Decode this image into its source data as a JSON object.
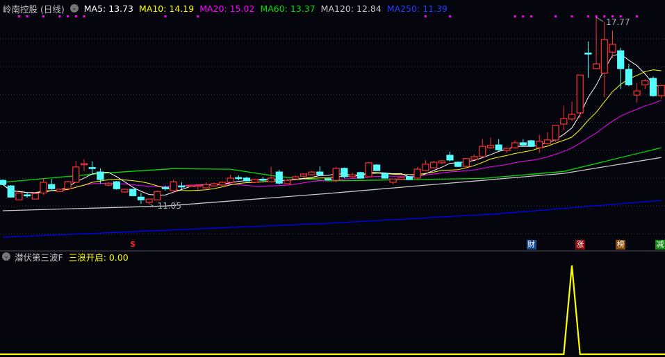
{
  "header": {
    "title": "岭南控股 (日线)",
    "ma5": "MA5: 13.73",
    "ma10": "MA10: 14.19",
    "ma20": "MA20: 15.02",
    "ma60": "MA60: 13.37",
    "ma120": "MA120: 12.84",
    "ma250": "MA250: 11.39"
  },
  "annotations": {
    "high_label": "17.77",
    "low_label": "11.05"
  },
  "markers": [
    {
      "text": "S",
      "index": 16,
      "color": "#ff2020"
    },
    {
      "text": "财",
      "index": 65,
      "color": "#1a4a8a"
    },
    {
      "text": "涨",
      "index": 71,
      "color": "#8a0a0a"
    },
    {
      "text": "榜",
      "index": 76,
      "color": "#8a4a0a"
    },
    {
      "text": "减",
      "index": 81,
      "color": "#108a10"
    }
  ],
  "sub": {
    "title": "潜伏第三波F",
    "value_label": "三浪开启: 0.00"
  },
  "colors": {
    "up": "#ff3232",
    "down": "#54ffff",
    "ma5": "#ffffff",
    "ma10": "#ffff00",
    "ma20": "#ff00ff",
    "ma60": "#00e000",
    "ma120": "#c8c8c8",
    "ma250": "#0000ff",
    "signal": "#ff00ff",
    "indicator": "#ffff00"
  },
  "chart_data": {
    "type": "candlestick",
    "title": "岭南控股 (日线)",
    "ohlc_fields": [
      "open",
      "high",
      "low",
      "close"
    ],
    "candles": [
      [
        11.92,
        11.95,
        11.75,
        11.77
      ],
      [
        11.72,
        11.75,
        11.3,
        11.32
      ],
      [
        11.22,
        11.47,
        11.22,
        11.47
      ],
      [
        11.4,
        11.5,
        11.3,
        11.37
      ],
      [
        11.25,
        11.45,
        11.25,
        11.45
      ],
      [
        11.47,
        12.0,
        11.4,
        11.85
      ],
      [
        11.77,
        11.97,
        11.57,
        11.62
      ],
      [
        11.52,
        11.62,
        11.5,
        11.6
      ],
      [
        11.62,
        11.9,
        11.6,
        11.87
      ],
      [
        11.85,
        12.62,
        11.85,
        12.4
      ],
      [
        12.48,
        12.68,
        12.25,
        12.52
      ],
      [
        12.38,
        12.6,
        12.15,
        12.35
      ],
      [
        12.22,
        12.35,
        11.8,
        11.95
      ],
      [
        11.75,
        11.85,
        11.7,
        11.82
      ],
      [
        11.87,
        11.9,
        11.58,
        11.62
      ],
      [
        11.5,
        11.62,
        11.48,
        11.6
      ],
      [
        11.6,
        11.62,
        11.35,
        11.37
      ],
      [
        11.32,
        11.47,
        11.08,
        11.22
      ],
      [
        11.13,
        11.25,
        11.05,
        11.25
      ],
      [
        11.22,
        11.55,
        11.2,
        11.52
      ],
      [
        11.67,
        11.72,
        11.55,
        11.62
      ],
      [
        11.55,
        11.95,
        11.45,
        11.87
      ],
      [
        11.72,
        11.85,
        11.6,
        11.7
      ],
      [
        11.7,
        11.75,
        11.68,
        11.74
      ],
      [
        11.7,
        11.76,
        11.58,
        11.74
      ],
      [
        11.65,
        11.85,
        11.62,
        11.77
      ],
      [
        11.72,
        11.85,
        11.7,
        11.8
      ],
      [
        11.75,
        11.88,
        11.72,
        11.85
      ],
      [
        11.85,
        12.12,
        11.82,
        12.0
      ],
      [
        12.02,
        12.1,
        11.92,
        12.0
      ],
      [
        12.0,
        12.05,
        11.88,
        11.9
      ],
      [
        11.85,
        11.98,
        11.82,
        11.95
      ],
      [
        11.96,
        12.05,
        11.88,
        11.94
      ],
      [
        11.87,
        12.4,
        11.85,
        12.0
      ],
      [
        12.22,
        12.3,
        11.78,
        11.82
      ],
      [
        11.8,
        11.97,
        11.78,
        11.92
      ],
      [
        11.97,
        12.1,
        11.95,
        12.05
      ],
      [
        12.07,
        12.17,
        12.0,
        12.15
      ],
      [
        12.12,
        12.25,
        12.1,
        12.22
      ],
      [
        12.22,
        12.42,
        12.1,
        12.12
      ],
      [
        11.98,
        12.0,
        11.92,
        11.95
      ],
      [
        11.92,
        12.4,
        11.85,
        12.35
      ],
      [
        12.35,
        12.38,
        12.0,
        12.05
      ],
      [
        12.05,
        12.2,
        12.0,
        12.12
      ],
      [
        12.2,
        12.23,
        11.97,
        12.0
      ],
      [
        12.05,
        12.58,
        12.02,
        12.55
      ],
      [
        12.47,
        12.5,
        12.25,
        12.27
      ],
      [
        12.17,
        12.2,
        11.98,
        12.0
      ],
      [
        11.85,
        11.98,
        11.78,
        11.97
      ],
      [
        11.95,
        12.05,
        11.93,
        12.02
      ],
      [
        12.05,
        12.07,
        11.92,
        11.95
      ],
      [
        12.0,
        12.4,
        11.97,
        12.32
      ],
      [
        12.27,
        12.65,
        12.25,
        12.5
      ],
      [
        12.37,
        12.62,
        12.35,
        12.57
      ],
      [
        12.55,
        12.65,
        12.5,
        12.62
      ],
      [
        12.82,
        12.95,
        12.6,
        12.65
      ],
      [
        12.57,
        12.6,
        12.4,
        12.42
      ],
      [
        12.42,
        12.72,
        12.4,
        12.7
      ],
      [
        12.67,
        12.85,
        12.65,
        12.77
      ],
      [
        12.77,
        13.4,
        12.75,
        13.14
      ],
      [
        13.09,
        13.45,
        13.05,
        13.17
      ],
      [
        13.19,
        13.4,
        12.98,
        13.02
      ],
      [
        12.99,
        13.1,
        12.9,
        13.07
      ],
      [
        13.09,
        13.35,
        13.05,
        13.27
      ],
      [
        13.27,
        13.4,
        13.15,
        13.19
      ],
      [
        13.34,
        13.37,
        13.12,
        13.14
      ],
      [
        13.09,
        13.55,
        12.9,
        13.32
      ],
      [
        13.24,
        13.65,
        13.2,
        13.37
      ],
      [
        13.37,
        13.9,
        13.3,
        13.89
      ],
      [
        13.94,
        14.6,
        13.72,
        14.14
      ],
      [
        14.12,
        14.75,
        14.05,
        14.29
      ],
      [
        14.34,
        15.7,
        14.15,
        15.7
      ],
      [
        16.49,
        16.9,
        15.6,
        16.45
      ],
      [
        15.93,
        17.77,
        15.9,
        16.1
      ],
      [
        15.77,
        17.6,
        14.9,
        16.97
      ],
      [
        16.52,
        17.3,
        16.3,
        16.8
      ],
      [
        16.57,
        16.68,
        15.2,
        15.93
      ],
      [
        15.9,
        16.1,
        15.3,
        15.35
      ],
      [
        14.98,
        15.4,
        14.7,
        15.13
      ],
      [
        15.35,
        15.55,
        15.2,
        15.5
      ],
      [
        15.58,
        15.65,
        14.92,
        14.96
      ],
      [
        14.96,
        15.32,
        14.85,
        15.32
      ]
    ],
    "ma_periods": [
      5,
      10,
      20
    ],
    "ma60_points": [
      [
        0,
        11.85
      ],
      [
        13,
        12.19
      ],
      [
        21,
        12.34
      ],
      [
        28,
        12.32
      ],
      [
        34,
        12.05
      ],
      [
        40,
        11.9
      ],
      [
        59,
        11.99
      ],
      [
        69,
        12.24
      ],
      [
        81,
        13.09
      ]
    ],
    "ma120_points": [
      [
        0,
        10.83
      ],
      [
        20,
        11.0
      ],
      [
        40,
        11.45
      ],
      [
        59,
        11.92
      ],
      [
        69,
        12.17
      ],
      [
        81,
        12.74
      ]
    ],
    "ma250_points": [
      [
        0,
        9.88
      ],
      [
        40,
        10.38
      ],
      [
        60,
        10.7
      ],
      [
        81,
        11.2
      ]
    ],
    "signal_dots": [
      2,
      3,
      5,
      7,
      8,
      9,
      10,
      20,
      24,
      52,
      55,
      63,
      64,
      65,
      68,
      70,
      72,
      73,
      74,
      75,
      76,
      78
    ],
    "high": {
      "index": 73,
      "value": 17.77
    },
    "low": {
      "index": 18,
      "value": 11.05
    },
    "gridlines": [
      11,
      12,
      13,
      14,
      15,
      16,
      17,
      10
    ],
    "indicator": {
      "name": "三浪开启",
      "nonzero": [
        [
          70,
          1
        ]
      ],
      "range": [
        0,
        1
      ]
    }
  }
}
